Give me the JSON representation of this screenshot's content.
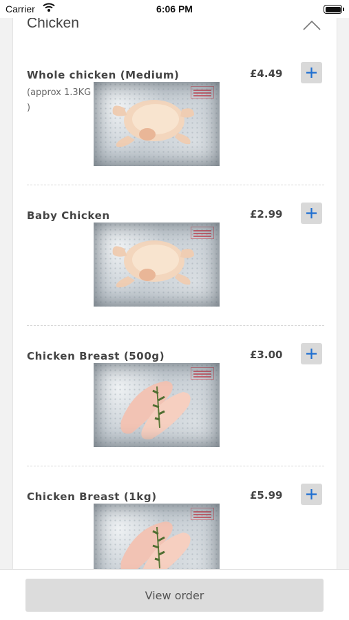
{
  "status_bar": {
    "carrier": "Carrier",
    "time": "6:06 PM"
  },
  "section": {
    "title": "Chicken",
    "collapse_icon": "chevron-up-icon"
  },
  "items": [
    {
      "name": "Whole chicken (Medium)",
      "description": "(approx 1.3KG )",
      "price": "£4.49",
      "add_icon": "plus-icon",
      "image": "whole-chicken-photo"
    },
    {
      "name": "Baby Chicken",
      "description": "",
      "price": "£2.99",
      "add_icon": "plus-icon",
      "image": "whole-chicken-photo"
    },
    {
      "name": "Chicken Breast (500g)",
      "description": "",
      "price": "£3.00",
      "add_icon": "plus-icon",
      "image": "chicken-breast-photo"
    },
    {
      "name": "Chicken Breast (1kg)",
      "description": "",
      "price": "£5.99",
      "add_icon": "plus-icon",
      "image": "chicken-breast-photo"
    }
  ],
  "footer": {
    "view_order_label": "View order"
  },
  "colors": {
    "accent": "#1f6fd1",
    "button_bg": "#d9d9d9",
    "background": "#f2f2f2"
  }
}
